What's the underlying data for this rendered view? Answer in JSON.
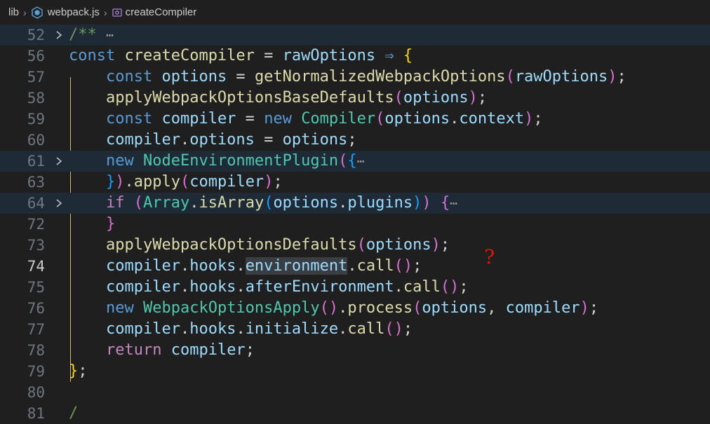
{
  "breadcrumb": {
    "folder": "lib",
    "file": "webpack.js",
    "symbol": "createCompiler"
  },
  "annotation": {
    "mark": "?"
  },
  "lines": [
    {
      "num": "52",
      "tokens": [
        [
          "/**",
          "cm"
        ],
        [
          " ",
          "pun"
        ],
        [
          "⋯",
          "ell"
        ]
      ]
    },
    {
      "num": "56",
      "tokens": [
        [
          "const",
          "kw"
        ],
        [
          " ",
          "pun"
        ],
        [
          "createCompiler",
          "fn"
        ],
        [
          " = ",
          "pun"
        ],
        [
          "rawOptions",
          "param"
        ],
        [
          " ⇒ ",
          "kw"
        ],
        [
          "{",
          "br1"
        ]
      ]
    },
    {
      "num": "57",
      "tokens": [
        [
          "    ",
          "pun"
        ],
        [
          "const",
          "kw"
        ],
        [
          " ",
          "pun"
        ],
        [
          "options",
          "var"
        ],
        [
          " = ",
          "pun"
        ],
        [
          "getNormalizedWebpackOptions",
          "fn"
        ],
        [
          "(",
          "br2"
        ],
        [
          "rawOptions",
          "param"
        ],
        [
          ")",
          "br2"
        ],
        [
          ";",
          "pun"
        ]
      ]
    },
    {
      "num": "58",
      "tokens": [
        [
          "    ",
          "pun"
        ],
        [
          "applyWebpackOptionsBaseDefaults",
          "fn"
        ],
        [
          "(",
          "br2"
        ],
        [
          "options",
          "var"
        ],
        [
          ")",
          "br2"
        ],
        [
          ";",
          "pun"
        ]
      ]
    },
    {
      "num": "59",
      "tokens": [
        [
          "    ",
          "pun"
        ],
        [
          "const",
          "kw"
        ],
        [
          " ",
          "pun"
        ],
        [
          "compiler",
          "var"
        ],
        [
          " = ",
          "pun"
        ],
        [
          "new",
          "kw"
        ],
        [
          " ",
          "pun"
        ],
        [
          "Compiler",
          "cls"
        ],
        [
          "(",
          "br2"
        ],
        [
          "options",
          "var"
        ],
        [
          ".",
          "pun"
        ],
        [
          "context",
          "var"
        ],
        [
          ")",
          "br2"
        ],
        [
          ";",
          "pun"
        ]
      ]
    },
    {
      "num": "60",
      "tokens": [
        [
          "    ",
          "pun"
        ],
        [
          "compiler",
          "var"
        ],
        [
          ".",
          "pun"
        ],
        [
          "options",
          "var"
        ],
        [
          " = ",
          "pun"
        ],
        [
          "options",
          "var"
        ],
        [
          ";",
          "pun"
        ]
      ]
    },
    {
      "num": "61",
      "tokens": [
        [
          "    ",
          "pun"
        ],
        [
          "new",
          "kw"
        ],
        [
          " ",
          "pun"
        ],
        [
          "NodeEnvironmentPlugin",
          "cls"
        ],
        [
          "(",
          "br2"
        ],
        [
          "{",
          "br3"
        ],
        [
          "⋯",
          "ell"
        ]
      ]
    },
    {
      "num": "63",
      "tokens": [
        [
          "    ",
          "pun"
        ],
        [
          "}",
          "br3"
        ],
        [
          ")",
          "br2"
        ],
        [
          ".",
          "pun"
        ],
        [
          "apply",
          "fn"
        ],
        [
          "(",
          "br2"
        ],
        [
          "compiler",
          "var"
        ],
        [
          ")",
          "br2"
        ],
        [
          ";",
          "pun"
        ]
      ]
    },
    {
      "num": "64",
      "tokens": [
        [
          "    ",
          "pun"
        ],
        [
          "if",
          "ctrl"
        ],
        [
          " ",
          "pun"
        ],
        [
          "(",
          "br2"
        ],
        [
          "Array",
          "cls"
        ],
        [
          ".",
          "pun"
        ],
        [
          "isArray",
          "fn"
        ],
        [
          "(",
          "br3"
        ],
        [
          "options",
          "var"
        ],
        [
          ".",
          "pun"
        ],
        [
          "plugins",
          "var"
        ],
        [
          ")",
          "br3"
        ],
        [
          ")",
          "br2"
        ],
        [
          " ",
          "pun"
        ],
        [
          "{",
          "br2"
        ],
        [
          "⋯",
          "ell"
        ]
      ]
    },
    {
      "num": "72",
      "tokens": [
        [
          "    ",
          "pun"
        ],
        [
          "}",
          "br2"
        ]
      ]
    },
    {
      "num": "73",
      "tokens": [
        [
          "    ",
          "pun"
        ],
        [
          "applyWebpackOptionsDefaults",
          "fn"
        ],
        [
          "(",
          "br2"
        ],
        [
          "options",
          "var"
        ],
        [
          ")",
          "br2"
        ],
        [
          ";",
          "pun"
        ]
      ]
    },
    {
      "num": "74",
      "tokens": [
        [
          "    ",
          "pun"
        ],
        [
          "compiler",
          "var"
        ],
        [
          ".",
          "pun"
        ],
        [
          "hooks",
          "var"
        ],
        [
          ".",
          "pun"
        ],
        [
          "environment",
          "var hl"
        ],
        [
          ".",
          "pun"
        ],
        [
          "call",
          "fn"
        ],
        [
          "()",
          "br2"
        ],
        [
          ";",
          "pun"
        ]
      ]
    },
    {
      "num": "75",
      "tokens": [
        [
          "    ",
          "pun"
        ],
        [
          "compiler",
          "var"
        ],
        [
          ".",
          "pun"
        ],
        [
          "hooks",
          "var"
        ],
        [
          ".",
          "pun"
        ],
        [
          "afterEnvironment",
          "var"
        ],
        [
          ".",
          "pun"
        ],
        [
          "call",
          "fn"
        ],
        [
          "()",
          "br2"
        ],
        [
          ";",
          "pun"
        ]
      ]
    },
    {
      "num": "76",
      "tokens": [
        [
          "    ",
          "pun"
        ],
        [
          "new",
          "kw"
        ],
        [
          " ",
          "pun"
        ],
        [
          "WebpackOptionsApply",
          "cls"
        ],
        [
          "()",
          "br2"
        ],
        [
          ".",
          "pun"
        ],
        [
          "process",
          "fn"
        ],
        [
          "(",
          "br2"
        ],
        [
          "options",
          "var"
        ],
        [
          ", ",
          "pun"
        ],
        [
          "compiler",
          "var"
        ],
        [
          ")",
          "br2"
        ],
        [
          ";",
          "pun"
        ]
      ]
    },
    {
      "num": "77",
      "tokens": [
        [
          "    ",
          "pun"
        ],
        [
          "compiler",
          "var"
        ],
        [
          ".",
          "pun"
        ],
        [
          "hooks",
          "var"
        ],
        [
          ".",
          "pun"
        ],
        [
          "initialize",
          "var"
        ],
        [
          ".",
          "pun"
        ],
        [
          "call",
          "fn"
        ],
        [
          "()",
          "br2"
        ],
        [
          ";",
          "pun"
        ]
      ]
    },
    {
      "num": "78",
      "tokens": [
        [
          "    ",
          "pun"
        ],
        [
          "return",
          "ctrl"
        ],
        [
          " ",
          "pun"
        ],
        [
          "compiler",
          "var"
        ],
        [
          ";",
          "pun"
        ]
      ]
    },
    {
      "num": "79",
      "tokens": [
        [
          "}",
          "br1"
        ],
        [
          ";",
          "pun"
        ]
      ]
    },
    {
      "num": "80",
      "tokens": []
    },
    {
      "num": "81",
      "tokens": [
        [
          "/",
          "cm"
        ]
      ]
    }
  ],
  "folded": [
    "52",
    "61",
    "64"
  ],
  "active_line": "74"
}
